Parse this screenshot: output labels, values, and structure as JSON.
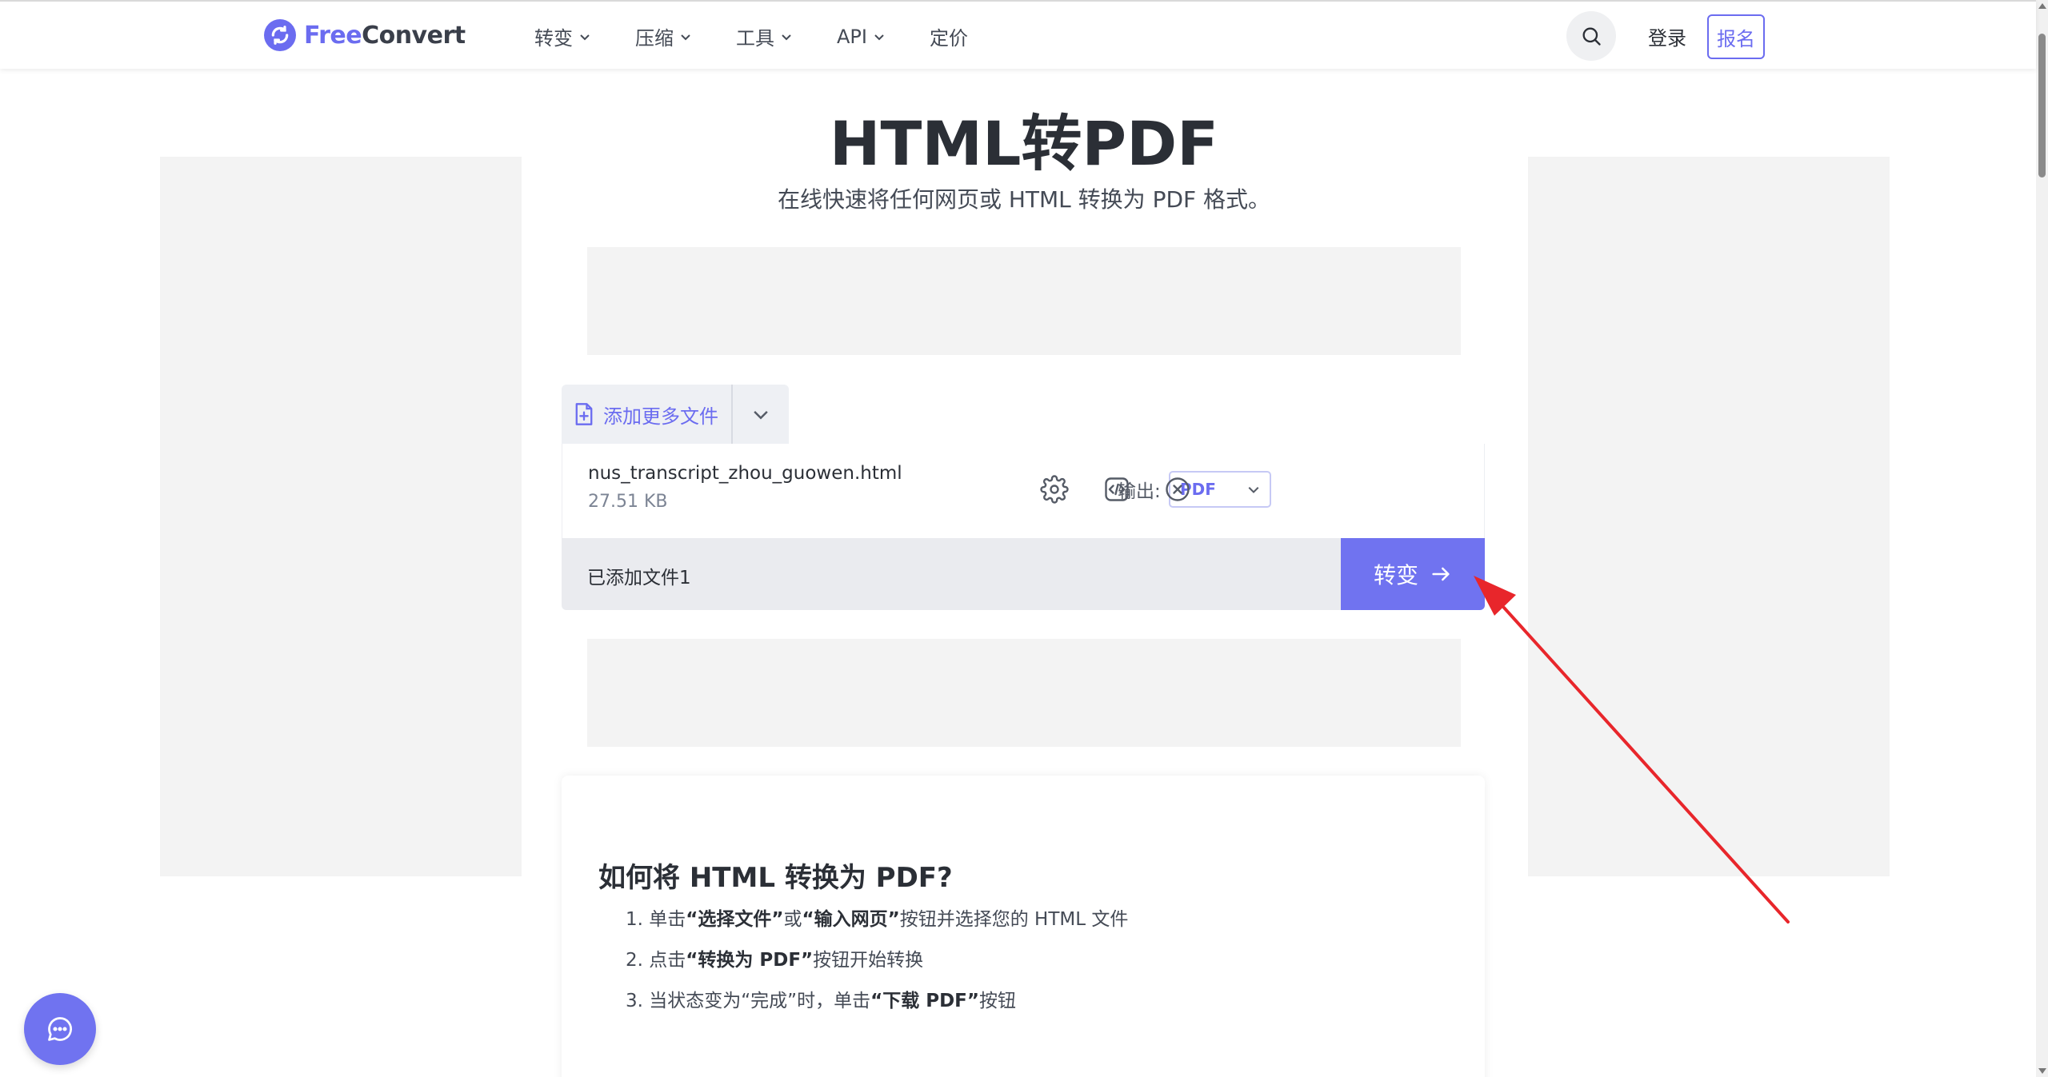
{
  "header": {
    "logo_free": "Free",
    "logo_convert": "Convert",
    "nav": [
      {
        "label": "转变",
        "has_dropdown": true
      },
      {
        "label": "压缩",
        "has_dropdown": true
      },
      {
        "label": "工具",
        "has_dropdown": true
      },
      {
        "label": "API",
        "has_dropdown": true
      },
      {
        "label": "定价",
        "has_dropdown": false
      }
    ],
    "login_label": "登录",
    "signup_label": "报名"
  },
  "page": {
    "title": "HTML转PDF",
    "subtitle": "在线快速将任何网页或 HTML 转换为 PDF 格式。"
  },
  "uploader": {
    "add_more_label": "添加更多文件",
    "file": {
      "name": "nus_transcript_zhou_guowen.html",
      "size": "27.51 KB",
      "output_label": "输出:",
      "output_value": "PDF"
    },
    "files_added": "已添加文件1",
    "convert_label": "转变"
  },
  "howto": {
    "title": "如何将 HTML 转换为 PDF?",
    "steps": [
      {
        "n": "1.",
        "pre": "单击",
        "b1": "“选择文件”",
        "mid": "或",
        "b2": "“输入网页”",
        "post": "按钮并选择您的 HTML 文件"
      },
      {
        "n": "2.",
        "pre": "点击",
        "b1": "“转换为 PDF”",
        "mid": "",
        "b2": "",
        "post": "按钮开始转换"
      },
      {
        "n": "3.",
        "pre": "当状态变为“完成”时，单击",
        "b1": "“下载 PDF”",
        "mid": "",
        "b2": "",
        "post": "按钮"
      }
    ]
  },
  "colors": {
    "accent": "#6b6cf0",
    "convert_button": "#7073f0",
    "annotation_arrow": "#e8262b"
  },
  "icons": {
    "logo": "refresh-icon",
    "search": "search-icon",
    "add_file": "file-plus-icon",
    "settings": "gear-icon",
    "embed": "code-file-icon",
    "remove": "close-circle-icon",
    "convert_arrow": "arrow-right-icon",
    "chat": "chat-bubble-icon"
  }
}
